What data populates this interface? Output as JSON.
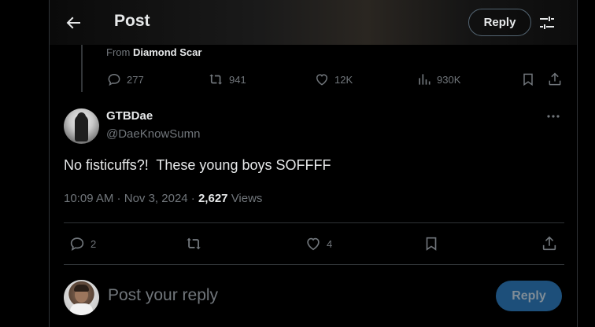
{
  "header": {
    "title": "Post",
    "reply_label": "Reply",
    "back_icon": "arrow-left-icon",
    "tune_icon": "sliders-icon"
  },
  "parent": {
    "from_prefix": "From",
    "from_name": "Diamond Scar",
    "stats": {
      "replies": "277",
      "reposts": "941",
      "likes": "12K",
      "views": "930K"
    }
  },
  "post": {
    "display_name": "GTBDae",
    "handle": "@DaeKnowSumn",
    "text": "No fisticuffs?!  These young boys SOFFFF",
    "time": "10:09 AM",
    "date": "Nov 3, 2024",
    "views_count": "2,627",
    "views_label": "Views",
    "actions": {
      "replies": "2",
      "reposts": "",
      "likes": "4"
    }
  },
  "composer": {
    "placeholder": "Post your reply",
    "button_label": "Reply"
  },
  "colors": {
    "background": "#000000",
    "text": "#e7e9ea",
    "muted": "#71767b",
    "border": "#2f3336",
    "reply_button": "#1d4f7a"
  }
}
